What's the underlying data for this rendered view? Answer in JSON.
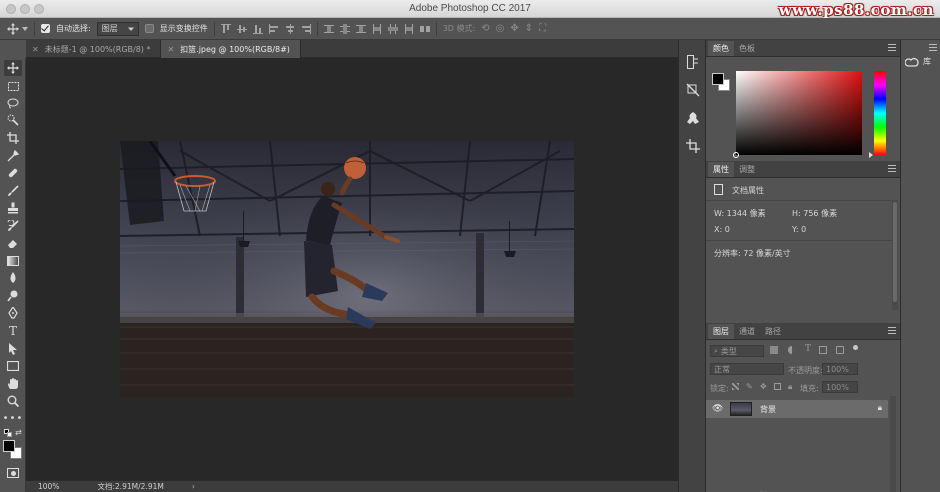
{
  "window": {
    "title": "Adobe Photoshop CC 2017",
    "watermark": "www.ps88.com.cn"
  },
  "options_bar": {
    "auto_select_label": "自动选择:",
    "auto_select_checked": true,
    "auto_select_target": "图层",
    "show_transform_label": "显示变换控件",
    "show_transform_checked": false,
    "mode_3d_label": "3D 模式:"
  },
  "tabs": [
    {
      "label": "未标题-1 @ 100%(RGB/8) *",
      "active": false
    },
    {
      "label": "扣篮.jpeg @ 100%(RGB/8#)",
      "active": true
    }
  ],
  "status": {
    "zoom": "100%",
    "doc_info": "文档:2.91M/2.91M"
  },
  "color_panel": {
    "tabs": [
      "颜色",
      "色板"
    ],
    "hue_color": "#e01010",
    "foreground": "#000000",
    "background": "#ffffff"
  },
  "properties_panel": {
    "tabs": [
      "属性",
      "调整"
    ],
    "header": "文档属性",
    "width": "W: 1344 像素",
    "height": "H: 756 像素",
    "x": "X: 0",
    "y": "Y: 0",
    "resolution": "分辨率: 72 像素/英寸"
  },
  "layers_panel": {
    "tabs": [
      "图层",
      "通道",
      "路径"
    ],
    "filter_kind": "类型",
    "blend_mode": "正常",
    "opacity_label": "不透明度:",
    "opacity_value": "100%",
    "lock_label": "锁定:",
    "fill_label": "填充:",
    "fill_value": "100%",
    "layers": [
      {
        "name": "背景",
        "visible": true,
        "locked": true,
        "selected": true
      }
    ]
  },
  "libraries": {
    "label": "库"
  }
}
